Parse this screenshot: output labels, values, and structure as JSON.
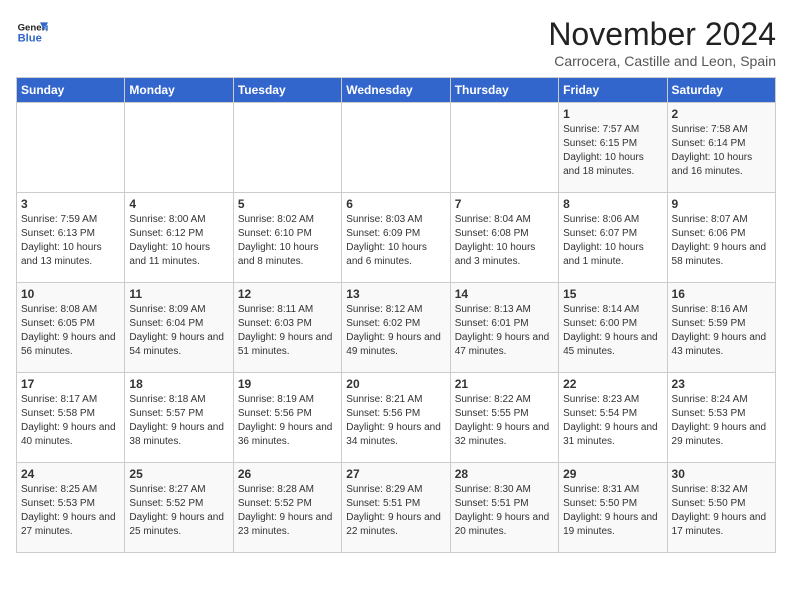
{
  "header": {
    "logo_line1": "General",
    "logo_line2": "Blue",
    "month": "November 2024",
    "location": "Carrocera, Castille and Leon, Spain"
  },
  "weekdays": [
    "Sunday",
    "Monday",
    "Tuesday",
    "Wednesday",
    "Thursday",
    "Friday",
    "Saturday"
  ],
  "weeks": [
    [
      {
        "day": "",
        "info": ""
      },
      {
        "day": "",
        "info": ""
      },
      {
        "day": "",
        "info": ""
      },
      {
        "day": "",
        "info": ""
      },
      {
        "day": "",
        "info": ""
      },
      {
        "day": "1",
        "info": "Sunrise: 7:57 AM\nSunset: 6:15 PM\nDaylight: 10 hours and 18 minutes."
      },
      {
        "day": "2",
        "info": "Sunrise: 7:58 AM\nSunset: 6:14 PM\nDaylight: 10 hours and 16 minutes."
      }
    ],
    [
      {
        "day": "3",
        "info": "Sunrise: 7:59 AM\nSunset: 6:13 PM\nDaylight: 10 hours and 13 minutes."
      },
      {
        "day": "4",
        "info": "Sunrise: 8:00 AM\nSunset: 6:12 PM\nDaylight: 10 hours and 11 minutes."
      },
      {
        "day": "5",
        "info": "Sunrise: 8:02 AM\nSunset: 6:10 PM\nDaylight: 10 hours and 8 minutes."
      },
      {
        "day": "6",
        "info": "Sunrise: 8:03 AM\nSunset: 6:09 PM\nDaylight: 10 hours and 6 minutes."
      },
      {
        "day": "7",
        "info": "Sunrise: 8:04 AM\nSunset: 6:08 PM\nDaylight: 10 hours and 3 minutes."
      },
      {
        "day": "8",
        "info": "Sunrise: 8:06 AM\nSunset: 6:07 PM\nDaylight: 10 hours and 1 minute."
      },
      {
        "day": "9",
        "info": "Sunrise: 8:07 AM\nSunset: 6:06 PM\nDaylight: 9 hours and 58 minutes."
      }
    ],
    [
      {
        "day": "10",
        "info": "Sunrise: 8:08 AM\nSunset: 6:05 PM\nDaylight: 9 hours and 56 minutes."
      },
      {
        "day": "11",
        "info": "Sunrise: 8:09 AM\nSunset: 6:04 PM\nDaylight: 9 hours and 54 minutes."
      },
      {
        "day": "12",
        "info": "Sunrise: 8:11 AM\nSunset: 6:03 PM\nDaylight: 9 hours and 51 minutes."
      },
      {
        "day": "13",
        "info": "Sunrise: 8:12 AM\nSunset: 6:02 PM\nDaylight: 9 hours and 49 minutes."
      },
      {
        "day": "14",
        "info": "Sunrise: 8:13 AM\nSunset: 6:01 PM\nDaylight: 9 hours and 47 minutes."
      },
      {
        "day": "15",
        "info": "Sunrise: 8:14 AM\nSunset: 6:00 PM\nDaylight: 9 hours and 45 minutes."
      },
      {
        "day": "16",
        "info": "Sunrise: 8:16 AM\nSunset: 5:59 PM\nDaylight: 9 hours and 43 minutes."
      }
    ],
    [
      {
        "day": "17",
        "info": "Sunrise: 8:17 AM\nSunset: 5:58 PM\nDaylight: 9 hours and 40 minutes."
      },
      {
        "day": "18",
        "info": "Sunrise: 8:18 AM\nSunset: 5:57 PM\nDaylight: 9 hours and 38 minutes."
      },
      {
        "day": "19",
        "info": "Sunrise: 8:19 AM\nSunset: 5:56 PM\nDaylight: 9 hours and 36 minutes."
      },
      {
        "day": "20",
        "info": "Sunrise: 8:21 AM\nSunset: 5:56 PM\nDaylight: 9 hours and 34 minutes."
      },
      {
        "day": "21",
        "info": "Sunrise: 8:22 AM\nSunset: 5:55 PM\nDaylight: 9 hours and 32 minutes."
      },
      {
        "day": "22",
        "info": "Sunrise: 8:23 AM\nSunset: 5:54 PM\nDaylight: 9 hours and 31 minutes."
      },
      {
        "day": "23",
        "info": "Sunrise: 8:24 AM\nSunset: 5:53 PM\nDaylight: 9 hours and 29 minutes."
      }
    ],
    [
      {
        "day": "24",
        "info": "Sunrise: 8:25 AM\nSunset: 5:53 PM\nDaylight: 9 hours and 27 minutes."
      },
      {
        "day": "25",
        "info": "Sunrise: 8:27 AM\nSunset: 5:52 PM\nDaylight: 9 hours and 25 minutes."
      },
      {
        "day": "26",
        "info": "Sunrise: 8:28 AM\nSunset: 5:52 PM\nDaylight: 9 hours and 23 minutes."
      },
      {
        "day": "27",
        "info": "Sunrise: 8:29 AM\nSunset: 5:51 PM\nDaylight: 9 hours and 22 minutes."
      },
      {
        "day": "28",
        "info": "Sunrise: 8:30 AM\nSunset: 5:51 PM\nDaylight: 9 hours and 20 minutes."
      },
      {
        "day": "29",
        "info": "Sunrise: 8:31 AM\nSunset: 5:50 PM\nDaylight: 9 hours and 19 minutes."
      },
      {
        "day": "30",
        "info": "Sunrise: 8:32 AM\nSunset: 5:50 PM\nDaylight: 9 hours and 17 minutes."
      }
    ]
  ]
}
